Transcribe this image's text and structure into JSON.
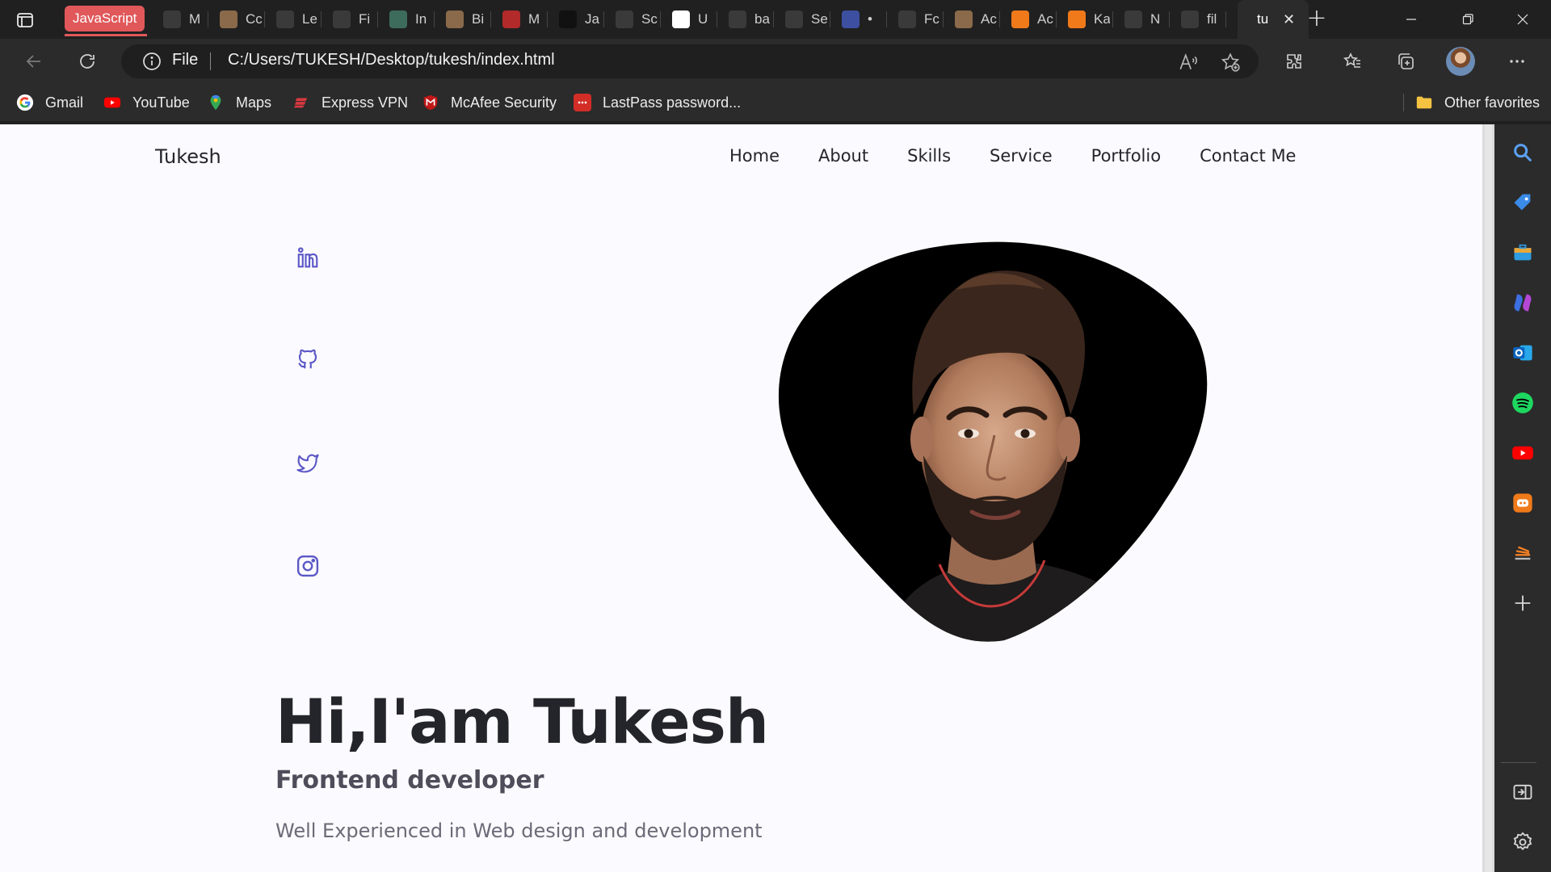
{
  "browser": {
    "tab_group_label": "JavaScript",
    "tabs": [
      {
        "title": "M",
        "icon": "code-tab-icon",
        "color": "#3a3a3a"
      },
      {
        "title": "Cc",
        "icon": "avatar-tab-icon",
        "color": "#8a6a4a"
      },
      {
        "title": "Le",
        "icon": "stack-tab-icon",
        "color": "#3a3a3a"
      },
      {
        "title": "Fi",
        "icon": "code-tab-icon",
        "color": "#3a3a3a"
      },
      {
        "title": "In",
        "icon": "chatgpt-tab-icon",
        "color": "#3d6b5c"
      },
      {
        "title": "Bi",
        "icon": "avatar-tab-icon",
        "color": "#8a6a4a"
      },
      {
        "title": "M",
        "icon": "m-tab-icon",
        "color": "#b22a2a"
      },
      {
        "title": "Ja",
        "icon": "r-tab-icon",
        "color": "#111111"
      },
      {
        "title": "Sc",
        "icon": "bars-tab-icon",
        "color": "#3a3a3a"
      },
      {
        "title": "U",
        "icon": "github-tab-icon",
        "color": "#ffffff"
      },
      {
        "title": "ba",
        "icon": "m-script-tab-icon",
        "color": "#3a3a3a"
      },
      {
        "title": "Se",
        "icon": "bars-tab-icon",
        "color": "#3a3a3a"
      },
      {
        "title": "•",
        "icon": "circle-tab-icon",
        "color": "#3c4fa0"
      },
      {
        "title": "Fc",
        "icon": "bars-tab-icon",
        "color": "#3a3a3a"
      },
      {
        "title": "Ac",
        "icon": "avatar-tab-icon",
        "color": "#8a6a4a"
      },
      {
        "title": "Ac",
        "icon": "orange-tab-icon",
        "color": "#f07a1a"
      },
      {
        "title": "Ka",
        "icon": "orange-tab-icon",
        "color": "#f07a1a"
      },
      {
        "title": "N",
        "icon": "calendar-tab-icon",
        "color": "#3a3a3a"
      },
      {
        "title": "fil",
        "icon": "file-tab-icon",
        "color": "#3a3a3a"
      }
    ],
    "active_tab": {
      "title": "tu",
      "close": "✕"
    },
    "new_tab": "+",
    "address": {
      "scheme": "File",
      "url": "C:/Users/TUKESH/Desktop/tukesh/index.html"
    },
    "favorites": [
      {
        "label": "Gmail",
        "icon": "google-icon"
      },
      {
        "label": "YouTube",
        "icon": "youtube-icon"
      },
      {
        "label": "Maps",
        "icon": "maps-icon"
      },
      {
        "label": "Express VPN",
        "icon": "expressvpn-icon"
      },
      {
        "label": "McAfee Security",
        "icon": "mcafee-icon"
      },
      {
        "label": "LastPass password...",
        "icon": "lastpass-icon"
      }
    ],
    "other_favorites": "Other favorites"
  },
  "page": {
    "logo": "Tukesh",
    "nav": [
      "Home",
      "About",
      "Skills",
      "Service",
      "Portfolio",
      "Contact Me"
    ],
    "socials": [
      "linkedin-icon",
      "github-icon",
      "twitter-icon",
      "instagram-icon"
    ],
    "hero": {
      "title": "Hi,I'am Tukesh",
      "subtitle": "Frontend developer",
      "description": "Well Experienced in Web design and development"
    },
    "colors": {
      "accent": "#5b57c6",
      "text": "#24252b",
      "background": "#fbfafe"
    }
  }
}
